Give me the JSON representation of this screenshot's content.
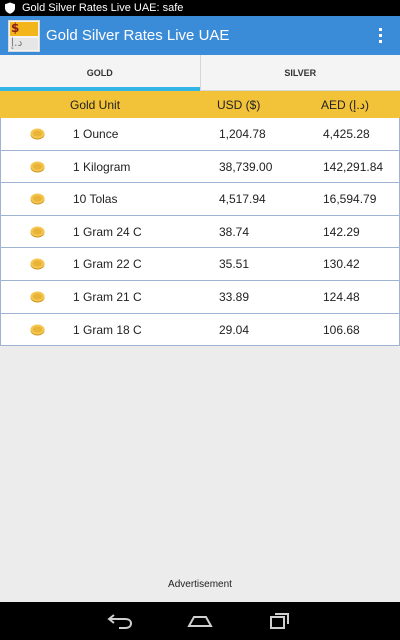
{
  "status_bar": {
    "text": "Gold Silver Rates Live UAE: safe",
    "icon": "shield-icon"
  },
  "action_bar": {
    "title": "Gold Silver Rates Live UAE",
    "app_icon_top": "$",
    "app_icon_bottom": "د.إ",
    "overflow_icon": "overflow-menu-icon",
    "color": "#3a8cd8"
  },
  "tabs": [
    {
      "label": "GOLD",
      "active": true
    },
    {
      "label": "SILVER",
      "active": false
    }
  ],
  "table": {
    "headers": {
      "unit": "Gold Unit",
      "usd": "USD ($)",
      "aed": "AED (د.إ)"
    },
    "header_color": "#f2c239",
    "rows": [
      {
        "unit": "1 Ounce",
        "usd": "1,204.78",
        "aed": "4,425.28"
      },
      {
        "unit": "1 Kilogram",
        "usd": "38,739.00",
        "aed": "142,291.84"
      },
      {
        "unit": "10 Tolas",
        "usd": "4,517.94",
        "aed": "16,594.79"
      },
      {
        "unit": "1 Gram 24 C",
        "usd": "38.74",
        "aed": "142.29"
      },
      {
        "unit": "1 Gram 22 C",
        "usd": "35.51",
        "aed": "130.42"
      },
      {
        "unit": "1 Gram 21 C",
        "usd": "33.89",
        "aed": "124.48"
      },
      {
        "unit": "1 Gram 18 C",
        "usd": "29.04",
        "aed": "106.68"
      }
    ],
    "row_icon": "gold-coin-icon"
  },
  "advertisement": "Advertisement",
  "nav_bar": {
    "back": "back-icon",
    "home": "home-icon",
    "recents": "recents-icon"
  }
}
